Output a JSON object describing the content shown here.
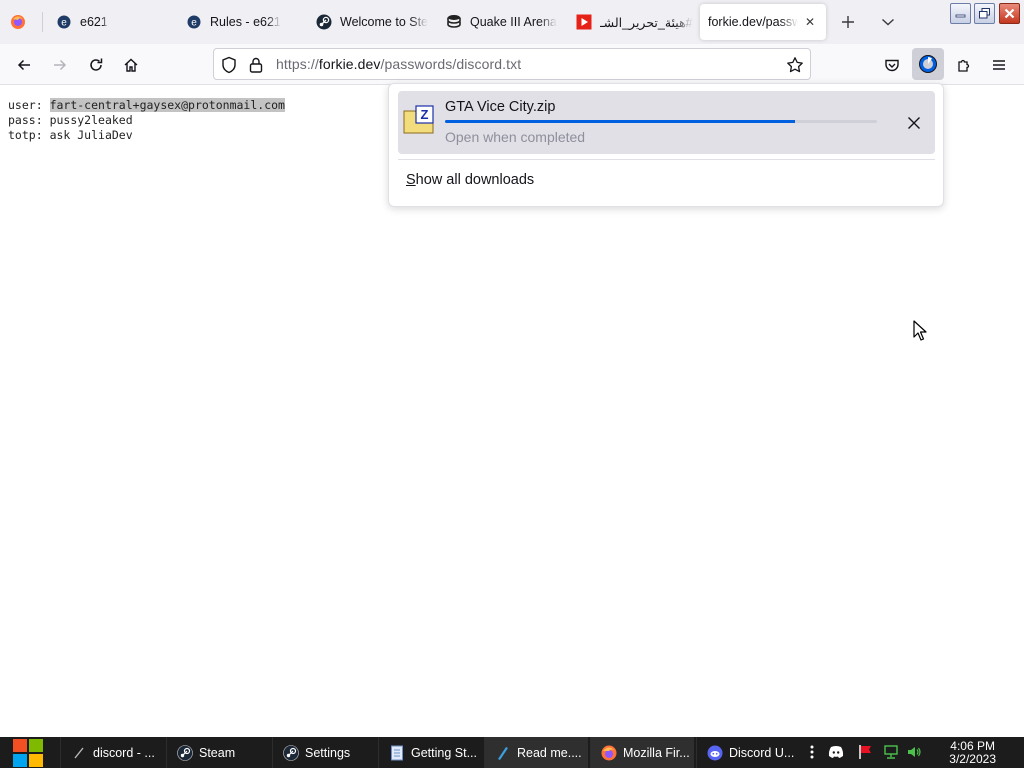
{
  "browser": {
    "tabs": [
      {
        "title": "",
        "icon": "firefox-view-icon",
        "active": false
      },
      {
        "title": "e621",
        "icon": "e621-favicon",
        "active": false
      },
      {
        "title": "Rules - e621",
        "icon": "e621-favicon",
        "active": false
      },
      {
        "title": "Welcome to Ste",
        "icon": "steam-favicon",
        "active": false
      },
      {
        "title": "Quake III Arena",
        "icon": "database-favicon",
        "active": false
      },
      {
        "title": "#هيئة_تحرير_الشـ",
        "icon": "youtube-favicon",
        "active": false
      },
      {
        "title": "forkie.dev/passw",
        "icon": "",
        "active": true
      }
    ],
    "url": {
      "scheme": "https://",
      "host": "forkie.dev",
      "path": "/passwords/discord.txt"
    }
  },
  "page": {
    "lines": [
      {
        "key": "user:",
        "value": "fart-central+gaysex@protonmail.com",
        "selected": true
      },
      {
        "key": "pass:",
        "value": "pussy2leaked",
        "selected": false
      },
      {
        "key": "totp:",
        "value": "ask JuliaDev",
        "selected": false
      }
    ]
  },
  "downloads": {
    "item": {
      "filename": "GTA Vice City.zip",
      "progress": 0.81,
      "status": "Open when completed"
    },
    "show_all": {
      "first_letter": "S",
      "rest": "how all downloads"
    }
  },
  "taskbar": {
    "items": [
      {
        "label": "discord - ...",
        "icon": "console-icon"
      },
      {
        "label": "Steam",
        "icon": "steam-icon"
      },
      {
        "label": "Settings",
        "icon": "steam-icon"
      },
      {
        "label": "Getting St...",
        "icon": "document-icon"
      },
      {
        "label": "Read me....",
        "icon": "text-icon"
      },
      {
        "label": "Mozilla Fir...",
        "icon": "firefox-icon"
      },
      {
        "label": "Discord U...",
        "icon": "discord-icon"
      }
    ],
    "clock": {
      "time": "4:06 PM",
      "date": "3/2/2023"
    }
  },
  "colors": {
    "accent": "#0060df",
    "tabstrip": "#f0f0f4",
    "taskbar": "#1c1c1c"
  }
}
